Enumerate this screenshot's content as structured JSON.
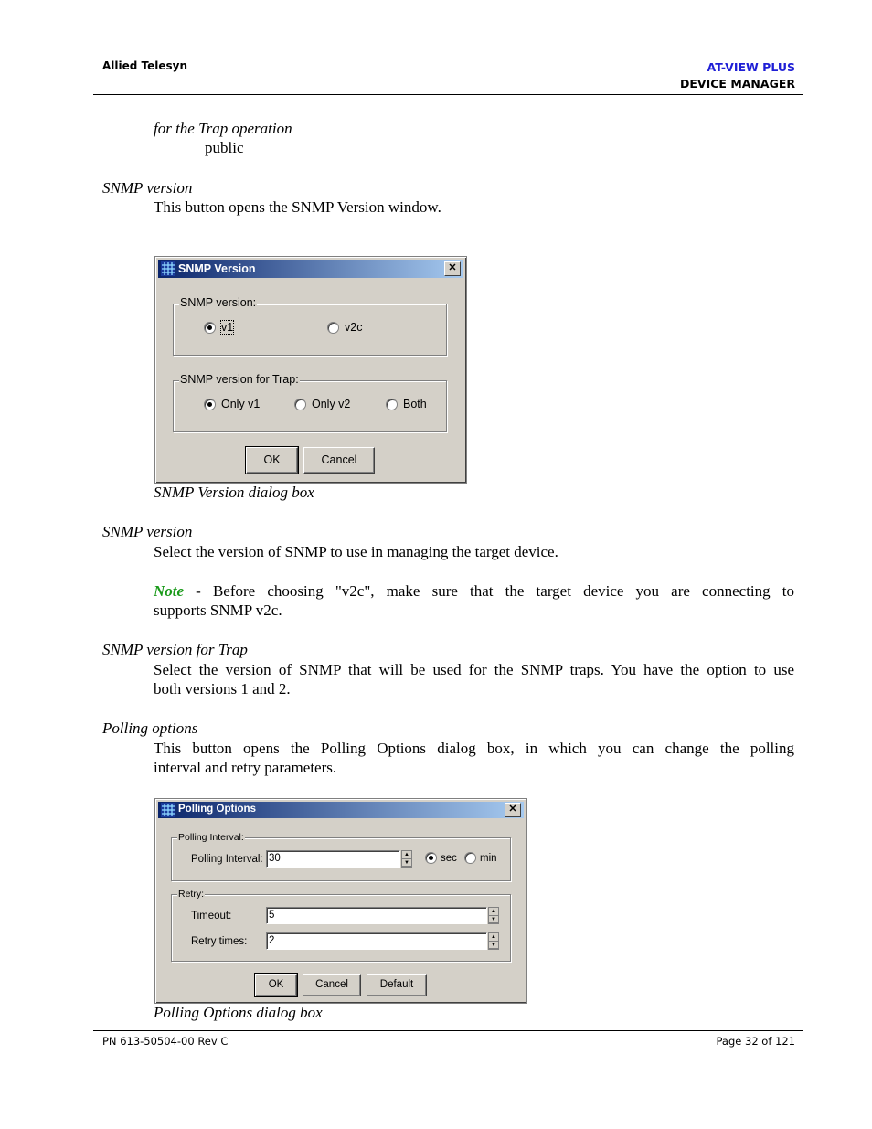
{
  "header": {
    "company": "Allied Telesyn",
    "product": "AT-VIEW PLUS",
    "module": "DEVICE MANAGER"
  },
  "body": {
    "trap_label": "for the Trap operation",
    "trap_value": "public",
    "snmp_version_heading": "SNMP version",
    "snmp_version_desc": "This button opens the SNMP Version window.",
    "snmp_caption": "SNMP Version dialog box",
    "snmp_version_heading2": "SNMP version",
    "snmp_version_desc2": "Select the version of SNMP to use in managing the target device.",
    "note_word": "Note",
    "note_line1": " - Before choosing \"v2c\", make sure that the target device you are connecting to",
    "note_line2": "supports SNMP v2c.",
    "trap_heading": "SNMP version for Trap",
    "trap_desc1": "Select the version of SNMP that will be used for the SNMP traps. You have the option to use",
    "trap_desc2": "both versions 1 and 2.",
    "polling_heading": "Polling options",
    "polling_desc1": "This button opens the Polling Options dialog box, in which you can change the polling",
    "polling_desc2": "interval and retry parameters.",
    "polling_caption": "Polling Options dialog box"
  },
  "snmp_dialog": {
    "title": "SNMP Version",
    "group1_label": "SNMP version:",
    "v1": "v1",
    "v2c": "v2c",
    "group2_label": "SNMP version for Trap:",
    "only_v1": "Only v1",
    "only_v2": "Only v2",
    "both": "Both",
    "ok": "OK",
    "cancel": "Cancel"
  },
  "polling_dialog": {
    "title": "Polling Options",
    "group1_label": "Polling Interval:",
    "interval_label": "Polling Interval:",
    "interval_value": "30",
    "sec": "sec",
    "min": "min",
    "group2_label": "Retry:",
    "timeout_label": "Timeout:",
    "timeout_value": "5",
    "retry_label": "Retry times:",
    "retry_value": "2",
    "ok": "OK",
    "cancel": "Cancel",
    "default": "Default"
  },
  "footer": {
    "part_number": "PN 613-50504-00 Rev C",
    "page": "Page 32 of 121"
  }
}
